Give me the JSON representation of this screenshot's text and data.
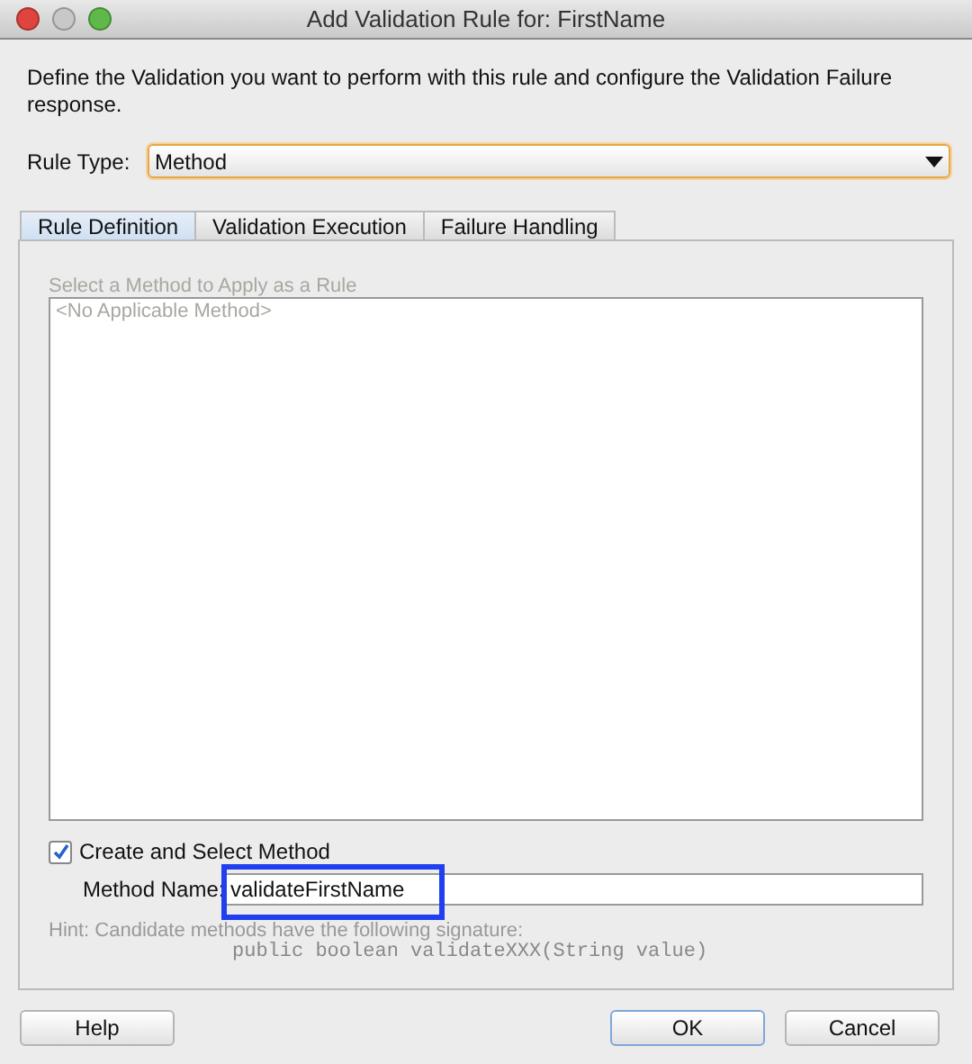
{
  "window": {
    "title": "Add Validation Rule for: FirstName"
  },
  "description": "Define the Validation you want to perform with this rule and configure the Validation Failure response.",
  "rule_type": {
    "label": "Rule Type:",
    "value": "Method"
  },
  "tabs": [
    {
      "label": "Rule Definition",
      "selected": true
    },
    {
      "label": "Validation Execution",
      "selected": false
    },
    {
      "label": "Failure Handling",
      "selected": false
    }
  ],
  "method_list": {
    "label": "Select a Method to Apply as a Rule",
    "items": [
      "<No Applicable Method>"
    ],
    "disabled": true
  },
  "create_method": {
    "label": "Create and Select Method",
    "checked": true
  },
  "method_name": {
    "label": "Method Name:",
    "value": "validateFirstName",
    "highlighted": true
  },
  "hint": {
    "text": "Hint: Candidate methods have the following signature:",
    "signature": "public boolean validateXXX(String value)"
  },
  "buttons": [
    {
      "label": "Help",
      "kind": "left",
      "default": false
    },
    {
      "label": "OK",
      "kind": "right",
      "default": true
    },
    {
      "label": "Cancel",
      "kind": "right",
      "default": false
    }
  ]
}
